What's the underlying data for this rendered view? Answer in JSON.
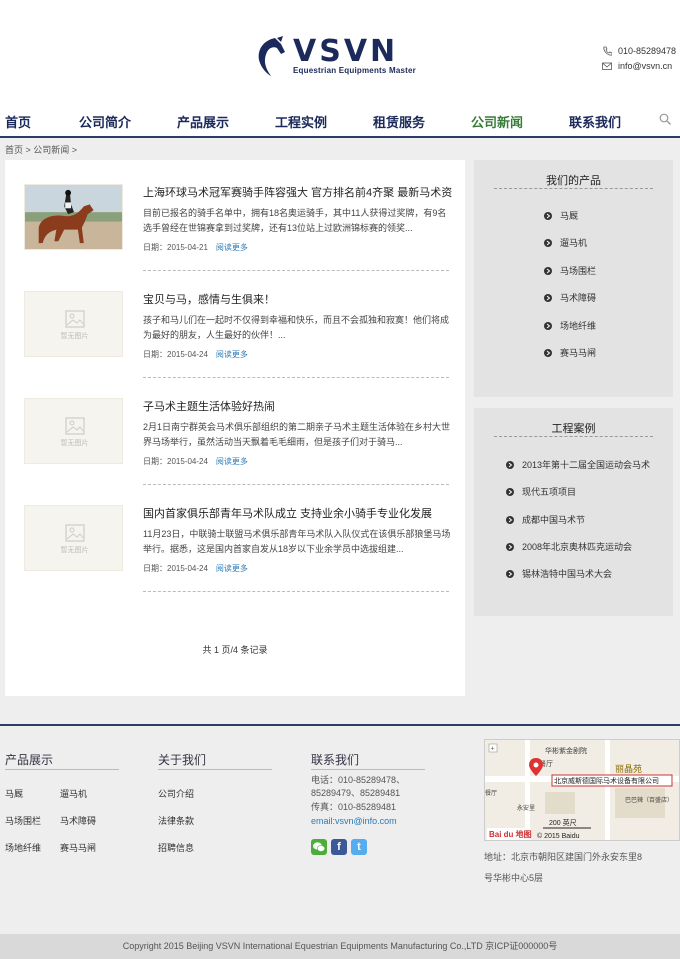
{
  "brand": {
    "name": "VSVN",
    "tagline": "Equestrian Equipments Master",
    "phone": "010-85289478",
    "email": "info@vsvn.cn"
  },
  "nav": {
    "items": [
      "首页",
      "公司简介",
      "产品展示",
      "工程实例",
      "租赁服务",
      "公司新闻",
      "联系我们"
    ],
    "active": "公司新闻"
  },
  "breadcrumb": "首页 > 公司新闻 >",
  "news": [
    {
      "title": "上海环球马术冠军赛骑手阵容强大 官方排名前4齐聚 最新马术资",
      "excerpt": "目前已报名的骑手名单中，拥有18名奥运骑手，其中11人获得过奖牌，有9名选手曾经在世锦赛拿到过奖牌，还有13位站上过欧洲锦标赛的领奖...",
      "date": "日期：2015-04-21",
      "more": "阅读更多",
      "has_image": true
    },
    {
      "title": "宝贝与马，感情与生俱来！",
      "excerpt": "孩子和马儿们在一起时不仅得到幸福和快乐，而且不会孤独和寂寞！他们将成为最好的朋友，人生最好的伙伴！...",
      "date": "日期：2015-04-24",
      "more": "阅读更多",
      "has_image": false
    },
    {
      "title": "子马术主题生活体验好热闹",
      "excerpt": "2月1日南宁群英会马术俱乐部组织的第二期亲子马术主题生活体验在乡村大世界马场举行，虽然活动当天飘着毛毛细雨，但是孩子们对于骑马...",
      "date": "日期：2015-04-24",
      "more": "阅读更多",
      "has_image": false
    },
    {
      "title": "国内首家俱乐部青年马术队成立 支持业余小骑手专业化发展",
      "excerpt": "11月23日，中联骑士联盟马术俱乐部青年马术队入队仪式在该俱乐部狼堡马场举行。据悉，这是国内首家自发从18岁以下业余学员中选拔组建...",
      "date": "日期：2015-04-24",
      "more": "阅读更多",
      "has_image": false
    }
  ],
  "placeholder_label": "暂无图片",
  "pager": "共 1 页/4 条记录",
  "sidebar": {
    "products": {
      "title": "我们的产品",
      "items": [
        "马厩",
        "遛马机",
        "马场围栏",
        "马术障碍",
        "场地纤维",
        "赛马马闸"
      ]
    },
    "cases": {
      "title": "工程案例",
      "items": [
        "2013年第十二届全国运动会马术",
        "现代五项项目",
        "成都中国马术节",
        "2008年北京奥林匹克运动会",
        "锡林浩特中国马术大会"
      ]
    }
  },
  "footer": {
    "products": {
      "title": "产品展示",
      "items": [
        "马厩",
        "遛马机",
        "马场围栏",
        "马术障碍",
        "场地纤维",
        "赛马马闸"
      ]
    },
    "about": {
      "title": "关于我们",
      "items": [
        "公司介绍",
        "法律条款",
        "招聘信息"
      ]
    },
    "contact": {
      "title": "联系我们",
      "line1": "电话：010-85289478、",
      "line2": "85289479、85289481",
      "fax": "传真：010-85289481",
      "email": "email:vsvn@info.com"
    },
    "map": {
      "company": "北京威斯德国际马术设备有限公司",
      "poi1": "华彬紫金剧院",
      "poi2": "丽晶苑",
      "poi3": "巴巴辣（百盛店）",
      "poi4": "永安里",
      "poi5": "餐厅",
      "scale": "200 英尺",
      "copyright": "© 2015 Baidu",
      "baidu": "Bai du 地图"
    },
    "address_line1": "地址：北京市朝阳区建国门外永安东里8",
    "address_line2": "号华彬中心5层"
  },
  "copyright": "Copyright 2015 Beijing VSVN International Equestrian Equipments Manufacturing Co.,LTD   京ICP证000000号",
  "colors": {
    "navy": "#1b2a5a",
    "active": "#3a7d3a",
    "link": "#2a7ab8"
  }
}
